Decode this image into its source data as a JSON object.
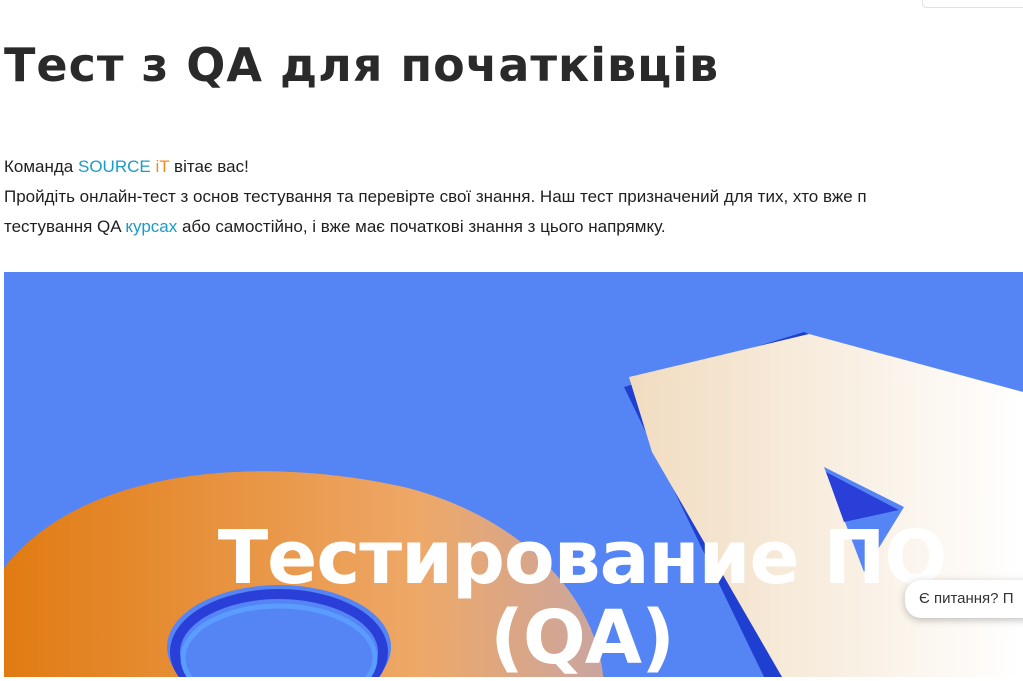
{
  "page": {
    "title": "Тест з QA для початківців"
  },
  "intro": {
    "greeting_prefix": "Команда ",
    "brand_source": "SOURCE",
    "brand_it": "iT",
    "greeting_suffix": " вітає вас!",
    "line2": "Пройдіть онлайн-тест з основ тестування та перевірте свої знання. Наш тест призначений для тих, хто вже п",
    "line3_prefix": "тестування QA ",
    "line3_link": "курсах",
    "line3_suffix": " або самостійно, і вже має початкові знання з цього напрямку."
  },
  "banner": {
    "title_line1": "Тестирование ПО",
    "title_line2": "(QA)"
  },
  "chat": {
    "label": "Є питання? П"
  },
  "colors": {
    "brand_blue": "#1a9cc8",
    "brand_orange": "#f08a1a",
    "banner_bg": "#5585f5"
  }
}
